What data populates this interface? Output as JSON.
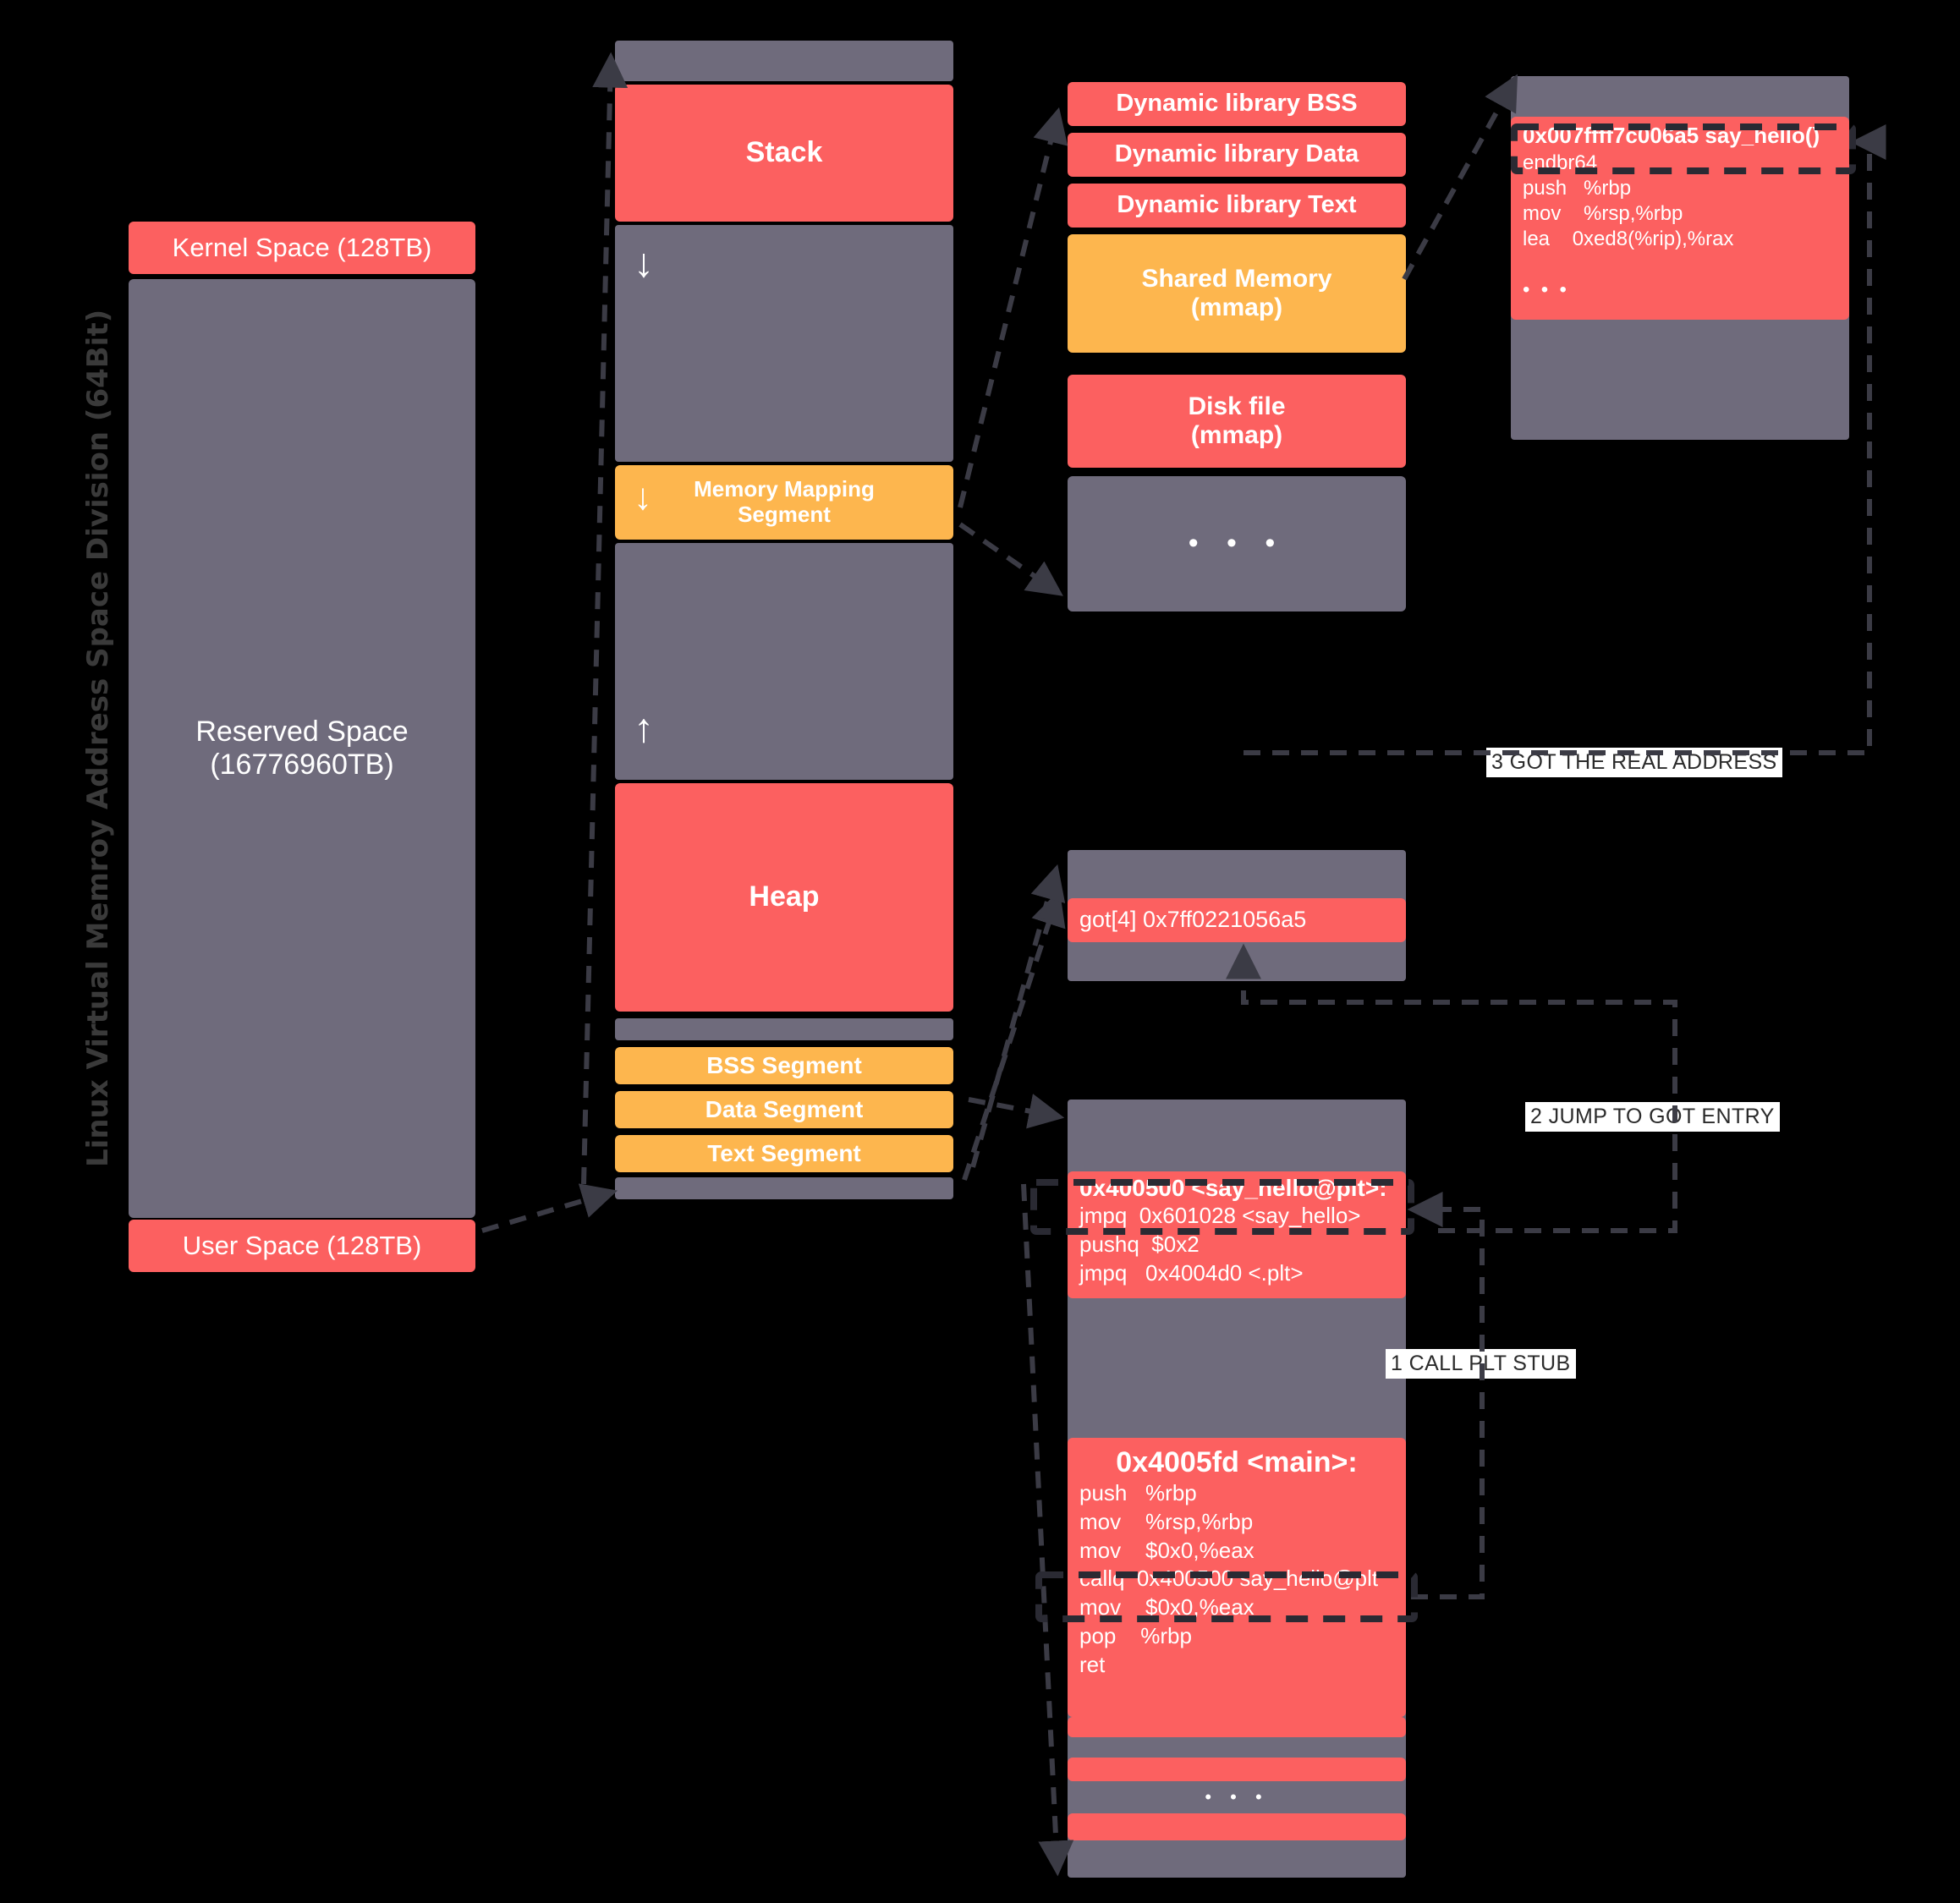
{
  "title": "Linux Virtual Memroy Address Space Division (64Bit)",
  "address_space": {
    "kernel": "Kernel Space (128TB)",
    "reserved": "Reserved Space\n(16776960TB)",
    "reserved_line1": "Reserved Space",
    "reserved_line2": "(16776960TB)",
    "user": "User Space (128TB)"
  },
  "process_layout": {
    "stack": "Stack",
    "grow_down_arrow": "↓",
    "mmap_line1": "Memory Mapping",
    "mmap_line2": "Segment",
    "grow_up_arrow": "↑",
    "heap": "Heap",
    "bss": "BSS Segment",
    "data": "Data Segment",
    "text": "Text Segment"
  },
  "mmap_detail": {
    "dyn_bss": "Dynamic library BSS",
    "dyn_data": "Dynamic library Data",
    "dyn_text": "Dynamic library Text",
    "shared_mem_l1": "Shared Memory",
    "shared_mem_l2": "(mmap)",
    "disk_file_l1": "Disk file",
    "disk_file_l2": "(mmap)",
    "ellipsis": "• • •"
  },
  "say_hello_impl": {
    "header": "0x007ffff7c006a5 say_hello()",
    "body": "endbr64\npush   %rbp\nmov    %rsp,%rbp\nlea    0xed8(%rip),%rax\n\n•  •  •"
  },
  "got": {
    "entry": "got[4]  0x7ff0221056a5"
  },
  "plt": {
    "header": "0x400500 <say_hello@plt>:",
    "body": "jmpq  0x601028 <say_hello>\npushq  $0x2\njmpq   0x4004d0 <.plt>"
  },
  "main_fn": {
    "header": "0x4005fd <main>:",
    "body": "push   %rbp\nmov    %rsp,%rbp\nmov    $0x0,%eax\ncallq  0x400500 say_hello@plt\nmov    $0x0,%eax\npop    %rbp\nret"
  },
  "steps": {
    "step1": "1 CALL PLT STUB",
    "step2": "2 JUMP TO GOT ENTRY",
    "step3": "3 GOT THE REAL ADDRESS"
  },
  "text_col_ellipsis": "• • •",
  "colors": {
    "red": "#fc6060",
    "gray": "#6f6b7c",
    "orange": "#fdb64e",
    "dash": "#3b3b45",
    "background": "#000000",
    "label_bg": "#ffffff"
  }
}
